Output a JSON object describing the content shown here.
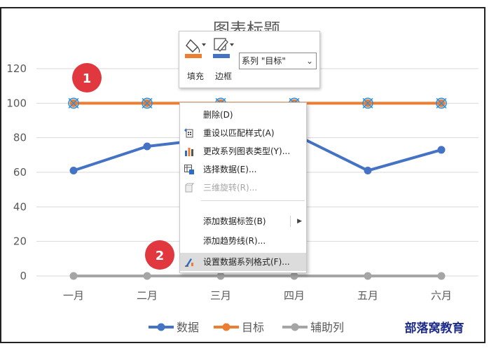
{
  "chart_data": {
    "type": "line",
    "title": "图表标题",
    "categories": [
      "一月",
      "二月",
      "三月",
      "四月",
      "五月",
      "六月"
    ],
    "series": [
      {
        "name": "数据",
        "values": [
          61,
          75,
          80,
          82,
          61,
          73
        ],
        "color": "#4472c4"
      },
      {
        "name": "目标",
        "values": [
          100,
          100,
          100,
          100,
          100,
          100
        ],
        "color": "#ed7d31"
      },
      {
        "name": "辅助列",
        "values": [
          0,
          0,
          0,
          0,
          0,
          0
        ],
        "color": "#a5a5a5"
      }
    ],
    "ylim": [
      0,
      120
    ],
    "yticks": [
      "0",
      "20",
      "40",
      "60",
      "80",
      "100",
      "120"
    ],
    "grid": true,
    "legend_position": "bottom"
  },
  "brand": "部落窝教育",
  "badges": [
    "1",
    "2"
  ],
  "mini_toolbar": {
    "fill_label": "填充",
    "border_label": "边框",
    "fill_icon": "paint-bucket-icon",
    "border_icon": "pen-icon",
    "accent_color": "#ed7d31",
    "border_color": "#4472c4",
    "series_select_value": "系列 \"目标\""
  },
  "context_menu": {
    "items": [
      {
        "label": "删除(D)",
        "icon": "",
        "disabled": false
      },
      {
        "label": "重设以匹配样式(A)",
        "icon": "reset-style-icon",
        "disabled": false
      },
      {
        "label": "更改系列图表类型(Y)...",
        "icon": "chart-type-icon",
        "disabled": false
      },
      {
        "label": "选择数据(E)...",
        "icon": "select-data-icon",
        "disabled": false
      },
      {
        "label": "三维旋转(R)...",
        "icon": "rotate-3d-icon",
        "disabled": true
      },
      {
        "label": "添加数据标签(B)",
        "icon": "",
        "disabled": false
      },
      {
        "label": "添加趋势线(R)...",
        "icon": "",
        "disabled": false
      },
      {
        "label": "设置数据系列格式(F)...",
        "icon": "format-series-icon",
        "disabled": false
      }
    ]
  }
}
